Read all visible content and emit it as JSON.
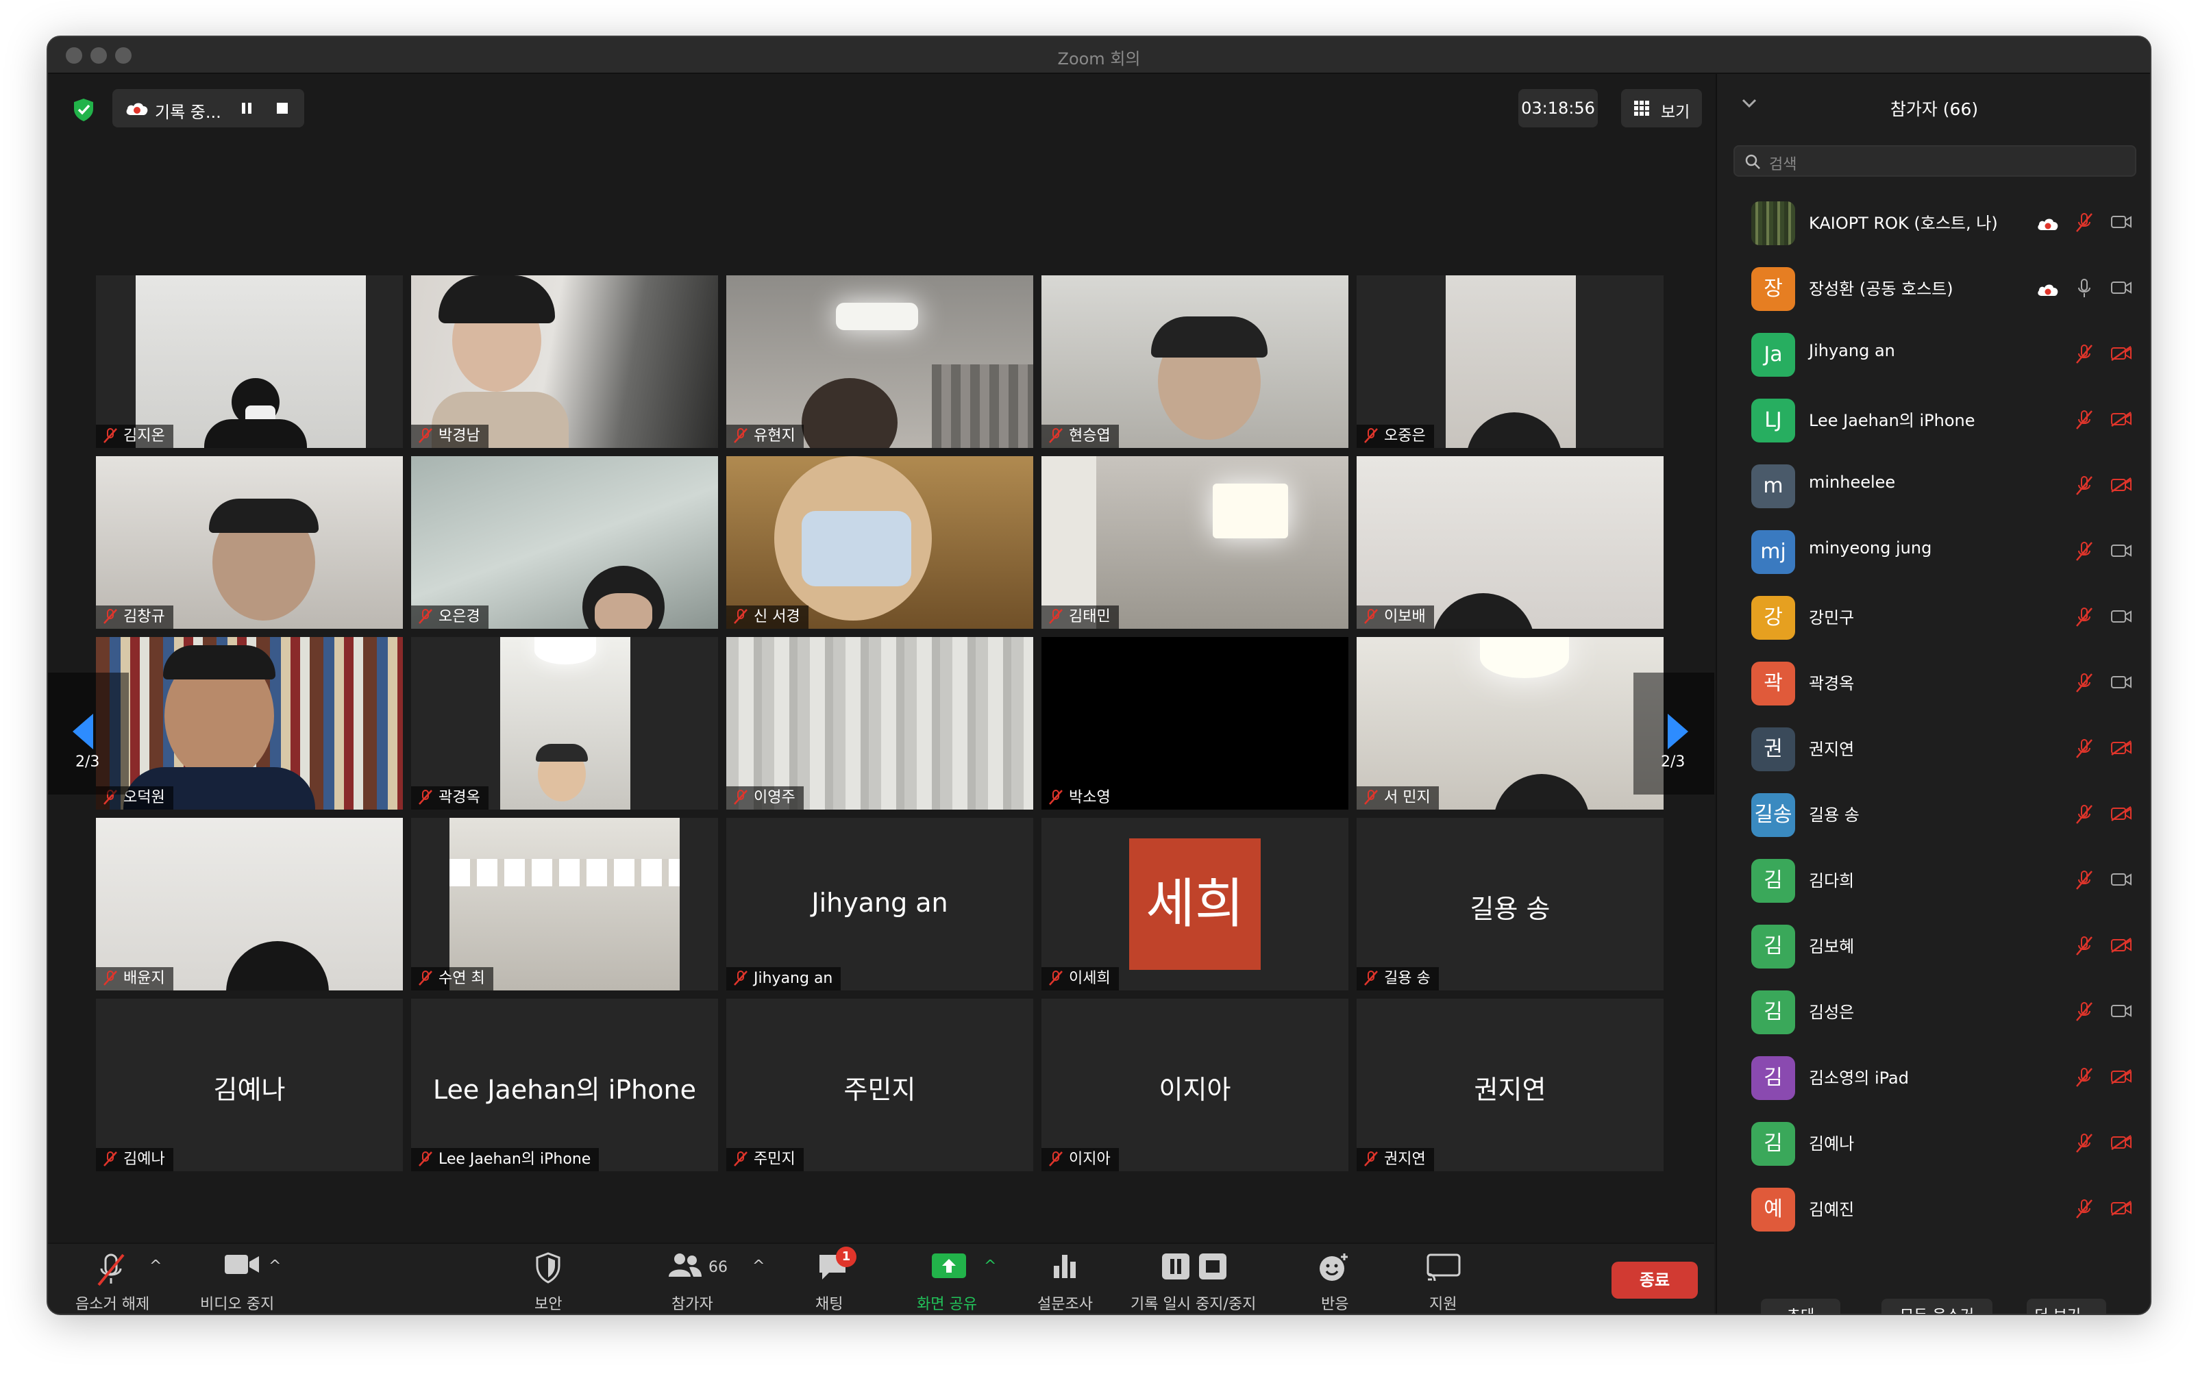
{
  "window": {
    "title": "Zoom 회의"
  },
  "top": {
    "recording_label": "기록 중...",
    "timer": "03:18:56",
    "view_label": "보기"
  },
  "tiles": [
    {
      "name": "김지온",
      "muted": true
    },
    {
      "name": "박경남",
      "muted": true
    },
    {
      "name": "유현지",
      "muted": true
    },
    {
      "name": "현승엽",
      "muted": true
    },
    {
      "name": "오중은",
      "muted": true
    },
    {
      "name": "김창규",
      "muted": true
    },
    {
      "name": "오은경",
      "muted": true
    },
    {
      "name": "신 서경",
      "muted": true
    },
    {
      "name": "김태민",
      "muted": true
    },
    {
      "name": "이보배",
      "muted": true
    },
    {
      "name": "오덕원",
      "muted": true
    },
    {
      "name": "곽경옥",
      "muted": true
    },
    {
      "name": "이영주",
      "muted": true
    },
    {
      "name": "박소영",
      "muted": true
    },
    {
      "name": "서 민지",
      "muted": true
    },
    {
      "name": "배윤지",
      "muted": true
    },
    {
      "name": "수연 최",
      "muted": true
    },
    {
      "name": "Jihyang an",
      "center": "Jihyang an",
      "muted": true
    },
    {
      "name": "이세희",
      "avatar": "세희",
      "muted": true
    },
    {
      "name": "길용 송",
      "center": "길용 송",
      "muted": true
    },
    {
      "name": "김예나",
      "center": "김예나",
      "muted": true
    },
    {
      "name": "Lee Jaehan의 iPhone",
      "center": "Lee Jaehan의 iPhone",
      "muted": true
    },
    {
      "name": "주민지",
      "center": "주민지",
      "muted": true
    },
    {
      "name": "이지아",
      "center": "이지아",
      "muted": true
    },
    {
      "name": "권지연",
      "center": "권지연",
      "muted": true
    }
  ],
  "pager": {
    "left": "2/3",
    "right": "2/3"
  },
  "toolbar": {
    "unmute": "음소거 해제",
    "stop_video": "비디오 중지",
    "security": "보안",
    "participants": "참가자",
    "participants_count": "66",
    "chat": "채팅",
    "chat_badge": "1",
    "share": "화면 공유",
    "polls": "설문조사",
    "record": "기록 일시 중지/중지",
    "reactions": "반응",
    "support": "지원",
    "end": "종료"
  },
  "panel": {
    "title": "참가자 (66)",
    "search_placeholder": "검색",
    "participants": [
      {
        "initials": "",
        "name": "KAIOPT ROK (호스트, 나)",
        "color": "#4a5a3a",
        "mic": "muted",
        "video": "on",
        "cloud": true
      },
      {
        "initials": "장",
        "name": "장성환 (공동 호스트)",
        "color": "#e67e22",
        "mic": "on",
        "video": "on",
        "cloud": true
      },
      {
        "initials": "Ja",
        "name": "Jihyang an",
        "color": "#27ae60",
        "mic": "muted",
        "video": "off"
      },
      {
        "initials": "LJ",
        "name": "Lee Jaehan의 iPhone",
        "color": "#27ae60",
        "mic": "muted",
        "video": "off"
      },
      {
        "initials": "m",
        "name": "minheelee",
        "color": "#4a5a6a",
        "mic": "muted",
        "video": "off"
      },
      {
        "initials": "mj",
        "name": "minyeong jung",
        "color": "#3a7ac0",
        "mic": "muted",
        "video": "on"
      },
      {
        "initials": "강",
        "name": "강민구",
        "color": "#e6a020",
        "mic": "muted",
        "video": "on"
      },
      {
        "initials": "곽",
        "name": "곽경옥",
        "color": "#e05a3a",
        "mic": "muted",
        "video": "on"
      },
      {
        "initials": "권",
        "name": "권지연",
        "color": "#3a4a5a",
        "mic": "muted",
        "video": "off"
      },
      {
        "initials": "길송",
        "name": "길용 송",
        "color": "#3a8ac0",
        "mic": "muted",
        "video": "off"
      },
      {
        "initials": "김",
        "name": "김다희",
        "color": "#3aa85a",
        "mic": "muted",
        "video": "on"
      },
      {
        "initials": "김",
        "name": "김보혜",
        "color": "#3aa85a",
        "mic": "muted",
        "video": "off"
      },
      {
        "initials": "김",
        "name": "김성은",
        "color": "#3aa85a",
        "mic": "muted",
        "video": "on"
      },
      {
        "initials": "김",
        "name": "김소영의 iPad",
        "color": "#8a4ab0",
        "mic": "muted",
        "video": "off"
      },
      {
        "initials": "김",
        "name": "김예나",
        "color": "#3aa85a",
        "mic": "muted",
        "video": "off"
      },
      {
        "initials": "예",
        "name": "김예진",
        "color": "#e05a3a",
        "mic": "muted",
        "video": "off"
      }
    ],
    "invite": "초대",
    "mute_all": "모두 음소거",
    "more": "더 보기"
  }
}
